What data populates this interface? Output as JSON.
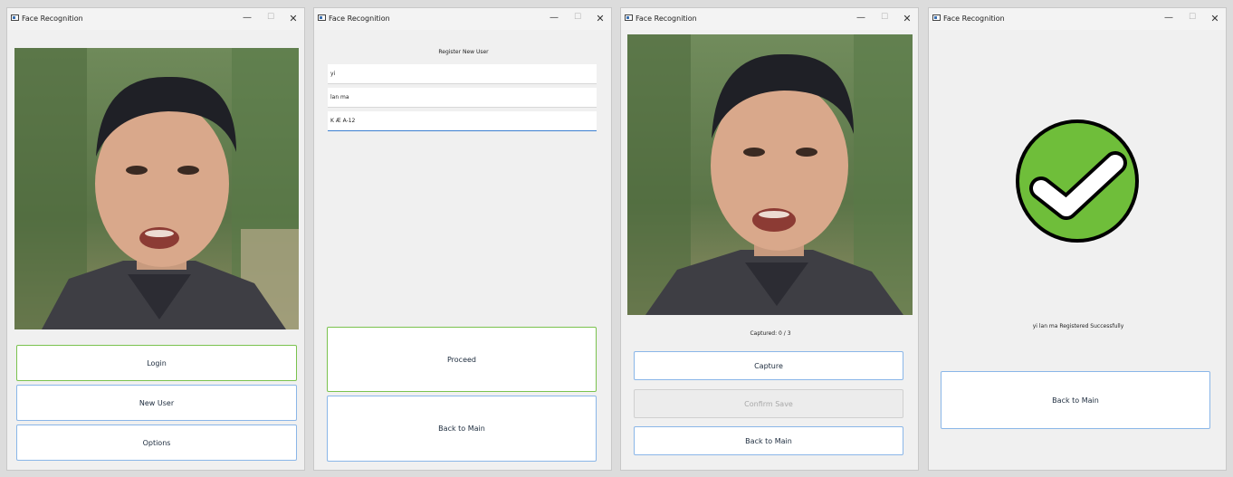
{
  "window_title": "Face Recognition",
  "controls": {
    "minimize": "—",
    "maximize": "☐",
    "close": "✕"
  },
  "main": {
    "login_label": "Login",
    "new_user_label": "New User",
    "options_label": "Options"
  },
  "register": {
    "heading": "Register New User",
    "first_name_value": "yi",
    "last_name_value": "lan ma",
    "id_value": "K Æ A-12",
    "proceed_label": "Proceed",
    "back_label": "Back to Main"
  },
  "capture": {
    "status_text": "Captured: 0 / 3",
    "capture_label": "Capture",
    "confirm_label": "Confirm  Save",
    "back_label": "Back to Main"
  },
  "success": {
    "message": "yi lan ma Registered Successfully",
    "back_label": "Back to Main"
  },
  "colors": {
    "accent_green": "#79c24f",
    "accent_blue": "#8ab6e8",
    "check_green": "#6fbe3a"
  }
}
